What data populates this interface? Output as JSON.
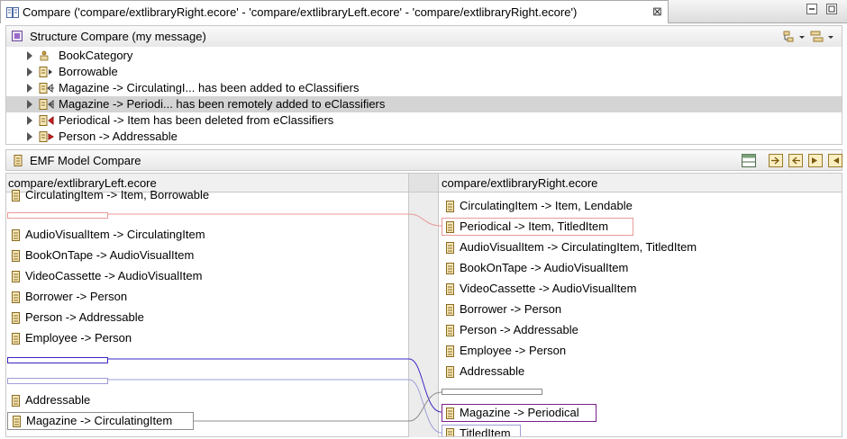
{
  "window": {
    "tab_title": "Compare ('compare/extlibraryRight.ecore' - 'compare/extlibraryLeft.ecore' - 'compare/extlibraryRight.ecore')",
    "close_glyph": "⊠"
  },
  "structure": {
    "title": "Structure Compare  (my message)",
    "items": [
      {
        "label": "BookCategory",
        "icon": "enum-icon"
      },
      {
        "label": "Borrowable",
        "icon": "class-change-icon"
      },
      {
        "label": "Magazine -> CirculatingI... has been added to eClassifiers",
        "icon": "class-add-icon"
      },
      {
        "label": "Magazine -> Periodi... has been remotely added to eClassifiers",
        "icon": "class-remote-add-icon",
        "selected": true
      },
      {
        "label": "Periodical -> Item has been deleted from eClassifiers",
        "icon": "class-delete-icon"
      },
      {
        "label": "Person -> Addressable",
        "icon": "class-change-icon"
      }
    ]
  },
  "emf": {
    "title": "EMF Model Compare"
  },
  "left": {
    "header": "compare/extlibraryLeft.ecore",
    "items": [
      "CirculatingItem -> Item, Borrowable",
      "AudioVisualItem -> CirculatingItem",
      "BookOnTape -> AudioVisualItem",
      "VideoCassette -> AudioVisualItem",
      "Borrower -> Person",
      "Person -> Addressable",
      "Employee -> Person",
      "Addressable",
      "Magazine -> CirculatingItem"
    ]
  },
  "right": {
    "header": "compare/extlibraryRight.ecore",
    "items": [
      "CirculatingItem -> Item, Lendable",
      "Periodical -> Item, TitledItem",
      "AudioVisualItem -> CirculatingItem, TitledItem",
      "BookOnTape -> AudioVisualItem",
      "VideoCassette -> AudioVisualItem",
      "Borrower -> Person",
      "Person -> Addressable",
      "Employee -> Person",
      "Addressable",
      "Magazine -> Periodical",
      "TitledItem"
    ]
  },
  "colors": {
    "deleted": "#e89a9a",
    "remote_added": "#7a1f8a",
    "added": "#9e9ed8",
    "conflict": "#3a28c0",
    "neutral": "#8c8c8c",
    "class_icon": "#c8a040"
  }
}
